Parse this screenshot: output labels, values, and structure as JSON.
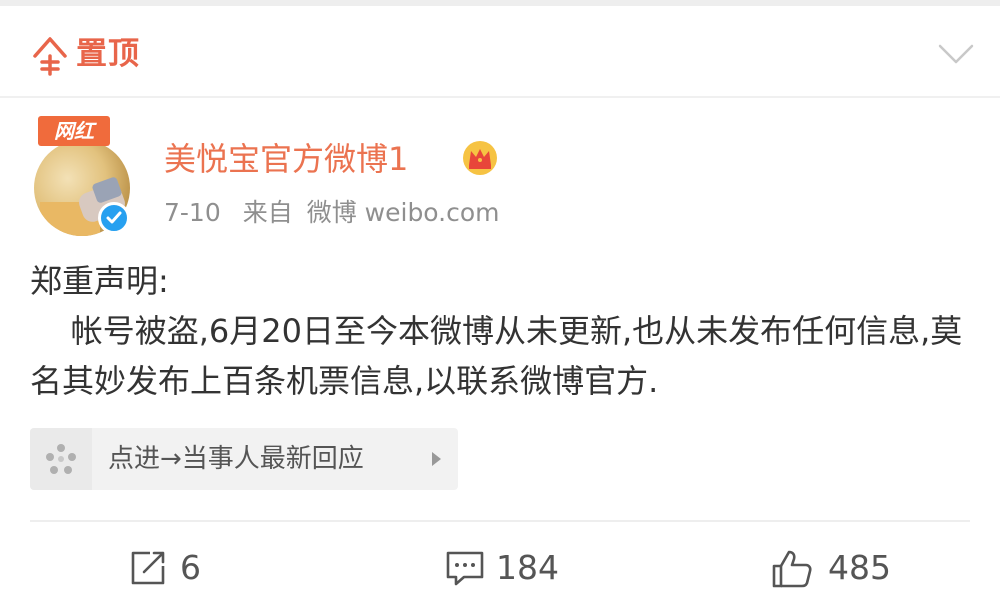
{
  "pinned": {
    "label": "置顶",
    "icon": "pin-top-icon",
    "expand_icon": "chevron-down-icon"
  },
  "author": {
    "avatar_tag": "网红",
    "name": "美悦宝官方微博1",
    "vip_icon": "crown-icon",
    "verified_icon": "verified-check-icon"
  },
  "meta": {
    "date": "7-10",
    "source_prefix": "来自",
    "source_name": "微博 weibo.com"
  },
  "post": {
    "text": "郑重声明:\n    帐号被盗,6月20日至今本微博从未更新,也从未发布任何信息,莫名其妙发布上百条机票信息,以联系微博官方."
  },
  "event_card": {
    "icon": "event-dots-icon",
    "label": "点进→当事人最新回应"
  },
  "actions": {
    "repost_count": "6",
    "comment_count": "184",
    "like_count": "485"
  },
  "colors": {
    "accent": "#eb7350",
    "verified": "#27a0f0",
    "text": "#333333",
    "muted": "#8f8f8f"
  }
}
